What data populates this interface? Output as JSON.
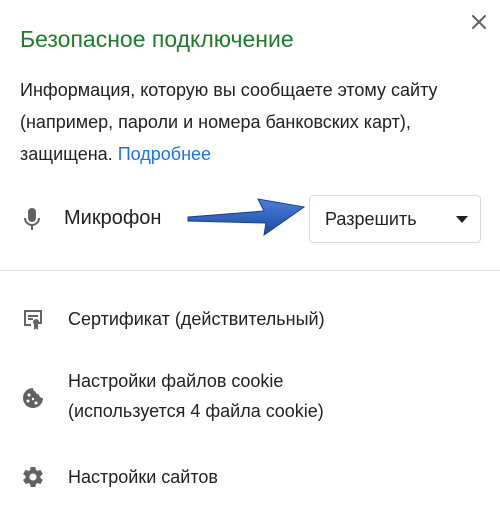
{
  "dialog": {
    "title": "Безопасное подключение",
    "description": "Информация, которую вы сообщаете этому сайту (например, пароли и номера банковских карт), защищена.",
    "learn_more_link": "Подробнее",
    "close_icon": "close-icon"
  },
  "permission": {
    "icon": "microphone-icon",
    "label": "Микрофон",
    "selected_value": "Разрешить",
    "annotation": "arrow-annotation"
  },
  "menu": {
    "certificate": {
      "icon": "certificate-icon",
      "label": "Сертификат (действительный)"
    },
    "cookies": {
      "icon": "cookie-icon",
      "label": "Настройки файлов cookie",
      "sublabel": "(используется 4 файла cookie)"
    },
    "site_settings": {
      "icon": "gear-icon",
      "label": "Настройки сайтов"
    }
  },
  "colors": {
    "title_green": "#1e7a2c",
    "link_blue": "#1a73e8",
    "arrow_blue": "#1f57b7",
    "icon_gray": "#5f6368",
    "divider": "#dadce0"
  }
}
